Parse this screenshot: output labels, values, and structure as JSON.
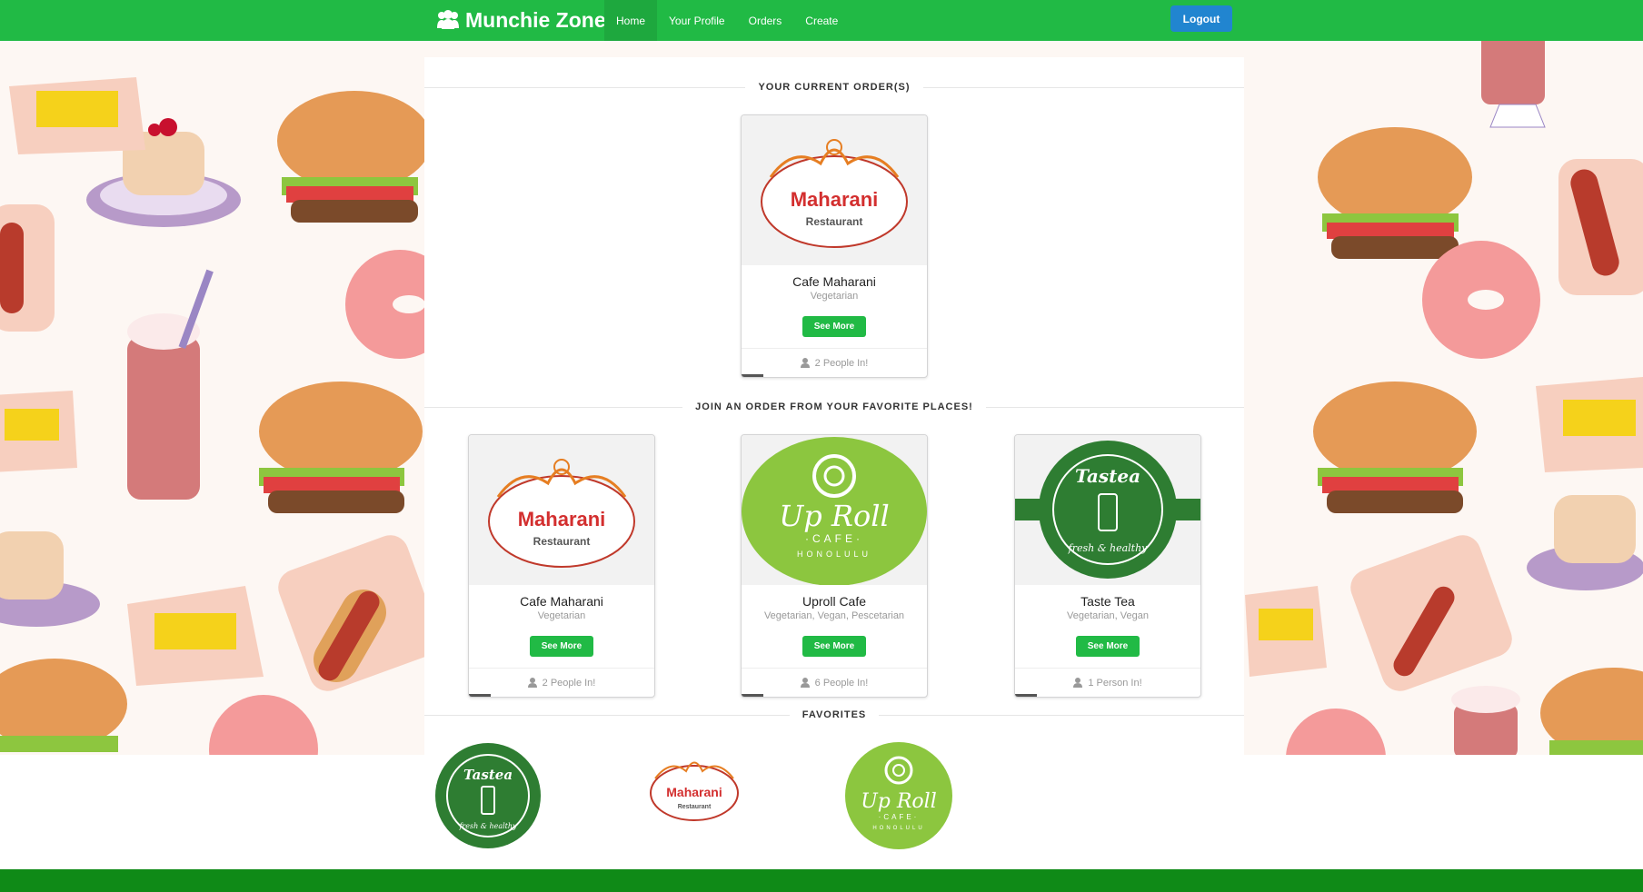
{
  "colors": {
    "nav_green": "#21ba45",
    "logout_blue": "#2185d0",
    "footer_green": "#0f8a17",
    "card_tags": "#999999"
  },
  "nav": {
    "brand": "Munchie Zone",
    "brand_icon": "users-icon",
    "items": [
      {
        "label": "Home",
        "active": true
      },
      {
        "label": "Your Profile",
        "active": false
      },
      {
        "label": "Orders",
        "active": false
      },
      {
        "label": "Create",
        "active": false
      }
    ],
    "logout_label": "Logout"
  },
  "sections": {
    "current_orders": "YOUR CURRENT ORDER(S)",
    "join_orders": "JOIN AN ORDER FROM YOUR FAVORITE PLACES!",
    "favorites": "FAVORITES"
  },
  "current_orders": [
    {
      "name": "Cafe Maharani",
      "tags": "Vegetarian",
      "button": "See More",
      "people": "2 People In!",
      "logo": "maharani",
      "logo_text": {
        "main": "Maharani",
        "sub": "Restaurant"
      }
    }
  ],
  "join_orders": [
    {
      "name": "Cafe Maharani",
      "tags": "Vegetarian",
      "button": "See More",
      "people": "2 People In!",
      "logo": "maharani",
      "logo_text": {
        "main": "Maharani",
        "sub": "Restaurant"
      }
    },
    {
      "name": "Uproll Cafe",
      "tags": "Vegetarian,  Vegan,  Pescetarian",
      "button": "See More",
      "people": "6 People In!",
      "logo": "uproll",
      "logo_text": {
        "main": "Up Roll",
        "sub": "·CAFE·",
        "sub2": "HONOLULU"
      }
    },
    {
      "name": "Taste Tea",
      "tags": "Vegetarian,  Vegan",
      "button": "See More",
      "people": "1 Person In!",
      "logo": "tastea",
      "logo_text": {
        "main": "Tastea",
        "sub": "fresh & healthy"
      }
    }
  ],
  "favorites": [
    {
      "logo": "tastea"
    },
    {
      "logo": "maharani"
    },
    {
      "logo": "uproll"
    }
  ]
}
